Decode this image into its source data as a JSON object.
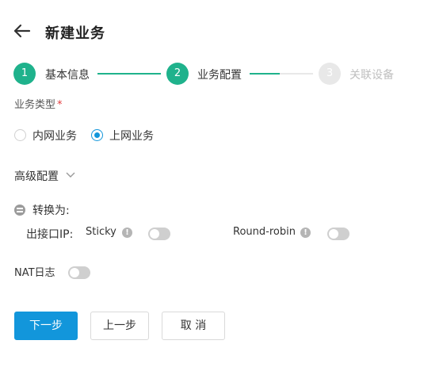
{
  "header": {
    "title": "新建业务",
    "back_icon": "arrow-left-icon"
  },
  "steps": [
    {
      "number": "1",
      "label": "基本信息",
      "state": "done"
    },
    {
      "number": "2",
      "label": "业务配置",
      "state": "active"
    },
    {
      "number": "3",
      "label": "关联设备",
      "state": "todo"
    }
  ],
  "form": {
    "business_type_label": "业务类型",
    "required_mark": "*",
    "options": [
      {
        "label": "内网业务",
        "checked": false
      },
      {
        "label": "上网业务",
        "checked": true
      }
    ],
    "advanced_label": "高级配置",
    "convert_label": "转换为:",
    "out_interface_label": "出接口IP:",
    "sticky_label": "Sticky",
    "sticky_enabled": false,
    "round_robin_label": "Round-robin",
    "round_robin_enabled": false,
    "nat_log_label": "NAT日志",
    "nat_log_enabled": false,
    "info_glyph": "!"
  },
  "buttons": {
    "next": "下一步",
    "prev": "上一步",
    "cancel": "取 消"
  },
  "colors": {
    "accent": "#1fb28c",
    "primary": "#1296db",
    "required": "#e2393b"
  }
}
